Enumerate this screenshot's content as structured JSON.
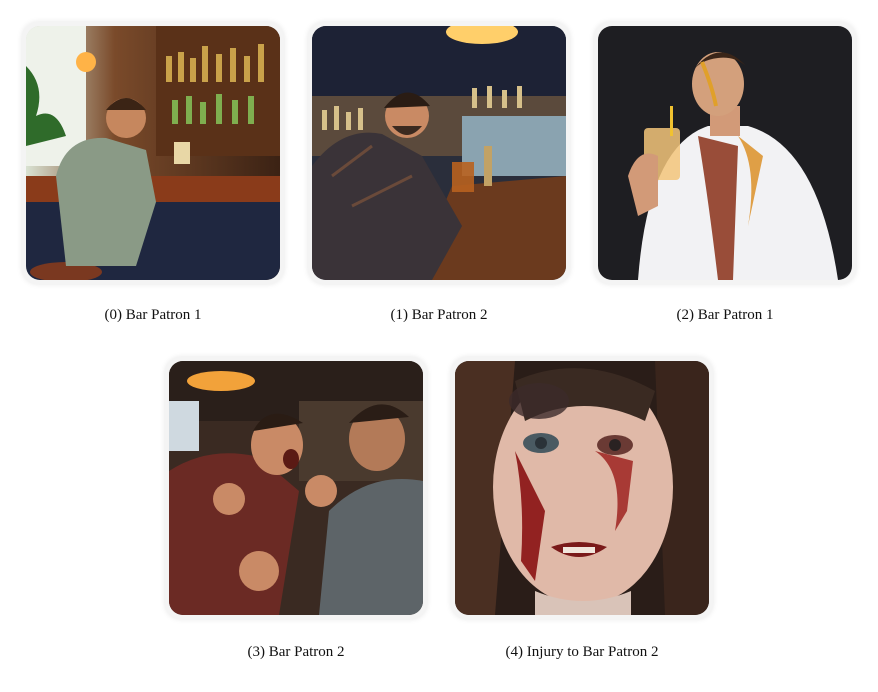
{
  "panels": [
    {
      "index": "(0)",
      "caption": "Bar Patron 1"
    },
    {
      "index": "(1)",
      "caption": "Bar Patron 2"
    },
    {
      "index": "(2)",
      "caption": "Bar Patron 1"
    },
    {
      "index": "(3)",
      "caption": "Bar Patron 2"
    },
    {
      "index": "(4)",
      "caption": "Injury to Bar Patron 2"
    }
  ]
}
